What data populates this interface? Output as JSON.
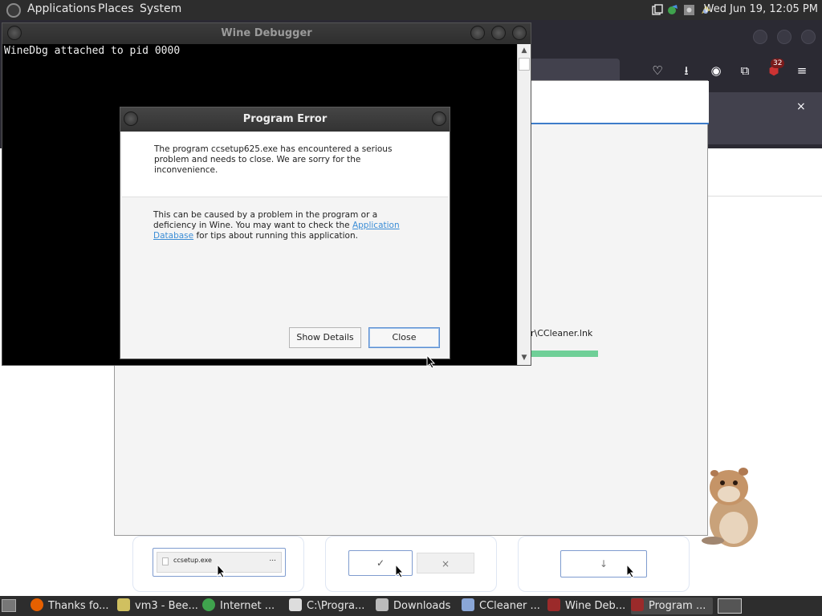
{
  "top_panel": {
    "menus": [
      "Applications",
      "Places",
      "System"
    ],
    "clock": "Wed Jun 19, 12:05 PM",
    "tray_icons": [
      "window-list-icon",
      "network-icon",
      "settings-icon",
      "wine-icon"
    ]
  },
  "browser": {
    "badge_count": "32",
    "notification_close": "×",
    "toolbar_icons": [
      "pocket-icon",
      "download-icon",
      "account-icon",
      "extensions-icon",
      "ublock-icon",
      "menu-icon"
    ]
  },
  "installer": {
    "install_path_text": "r\\CCleaner.lnk",
    "progress_color": "#6fcf97"
  },
  "wine_debugger": {
    "title": "Wine Debugger",
    "output": "WineDbg attached to pid 0000"
  },
  "error_dialog": {
    "title": "Program Error",
    "message1": "The program ccsetup625.exe has encountered a serious problem and needs to close. We are sorry for the inconvenience.",
    "message2_part1": "This can be caused by a problem in the program or a deficiency in Wine. You may want to check the",
    "link_text": "Application Database",
    "message2_part2": "for tips about running this application.",
    "show_details_label": "Show Details",
    "close_label": "Close"
  },
  "downloads": {
    "file_name": "ccsetup.exe",
    "more": "...",
    "accept": "✓",
    "reject": "×",
    "download": "↓"
  },
  "taskbar": {
    "tasks": [
      "Thanks fo...",
      "vm3 - Bee...",
      "Internet ...",
      "C:\\Progra...",
      "Downloads",
      "CCleaner ...",
      "Wine Deb...",
      "Program ..."
    ]
  },
  "colors": {
    "panel": "#2d2d2d",
    "accent_blue": "#3d7cc9",
    "link": "#3b8dd6"
  }
}
